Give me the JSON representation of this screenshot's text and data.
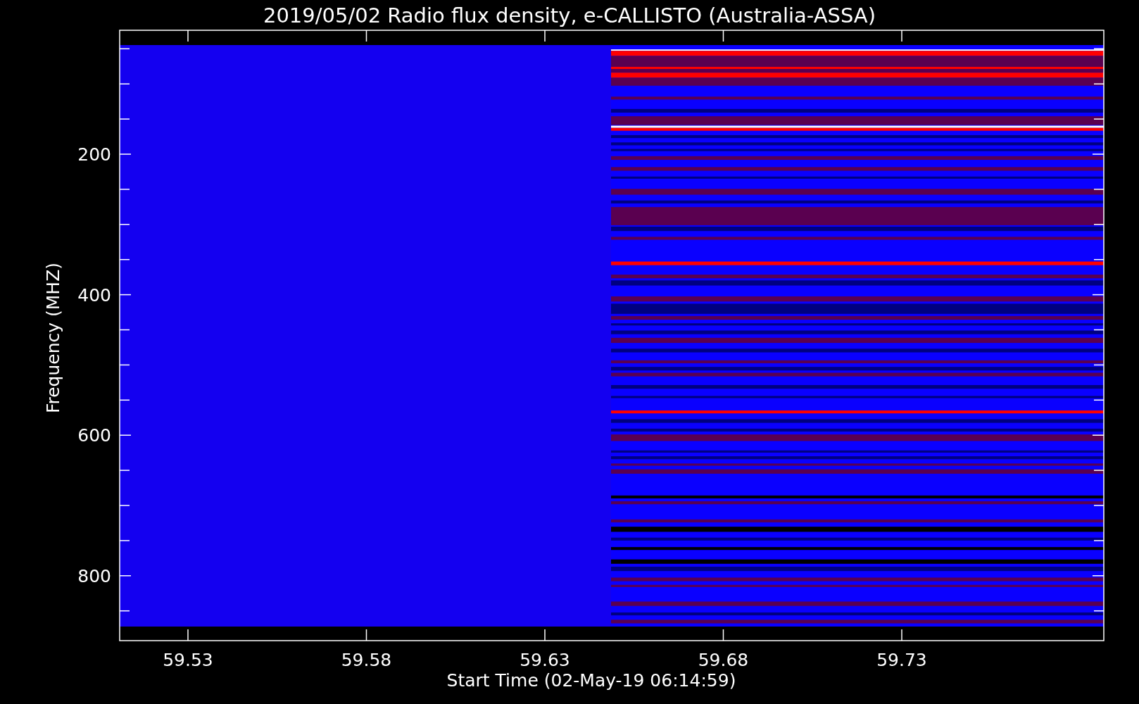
{
  "title": "2019/05/02  Radio flux density, e-CALLISTO (Australia-ASSA)",
  "x_axis": {
    "label": "Start Time (02-May-19 06:14:59)",
    "ticks": [
      "59.53",
      "59.58",
      "59.63",
      "59.68",
      "59.73"
    ]
  },
  "y_axis": {
    "label": "Frequency (MHZ)",
    "ticks": [
      "200",
      "400",
      "600",
      "800"
    ]
  }
}
